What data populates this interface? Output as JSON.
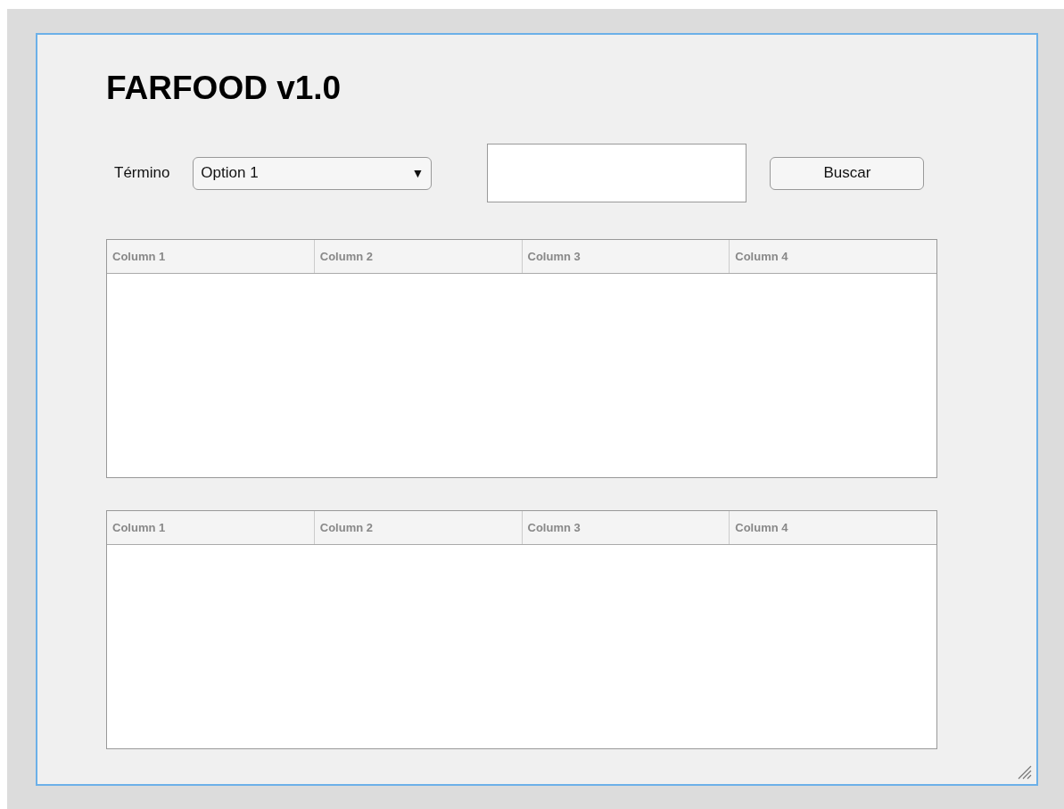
{
  "title": "FARFOOD v1.0",
  "search": {
    "label": "Término",
    "dropdown": {
      "value": "Option 1",
      "arrow": "▼"
    },
    "button": "Buscar"
  },
  "tables": [
    {
      "columns": [
        "Column 1",
        "Column 2",
        "Column 3",
        "Column 4"
      ]
    },
    {
      "columns": [
        "Column 1",
        "Column 2",
        "Column 3",
        "Column 4"
      ]
    }
  ]
}
